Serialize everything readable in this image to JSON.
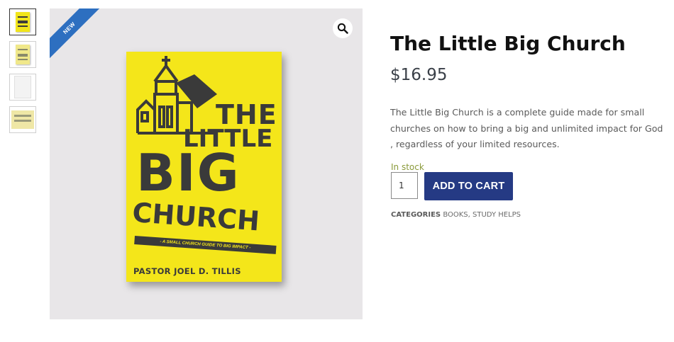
{
  "thumbnails": [
    "book-cover-front",
    "book-cover-alt",
    "book-pages",
    "book-back"
  ],
  "gallery": {
    "badge": "NEW",
    "cover": {
      "line1": "THE",
      "line2": "LITTLE",
      "line3": "BIG",
      "line4": "CHURCH",
      "subtitle": "- A SMALL CHURCH GUIDE TO BIG IMPACT -",
      "author": "PASTOR JOEL D. TILLIS"
    }
  },
  "product": {
    "title": "The Little Big Church",
    "price": "$16.95",
    "description": "The Little Big Church is a complete guide made for small churches on how to bring a big and unlimited impact for God , regardless of your limited resources.",
    "stock": "In stock",
    "quantity": "1",
    "add_to_cart": "ADD TO CART",
    "categories_label": "CATEGORIES",
    "category_1": "BOOKS",
    "separator": ",",
    "category_2": "STUDY HELPS"
  },
  "colors": {
    "accent": "#253a84",
    "badge": "#2d6fc0",
    "cover": "#f4e61a",
    "stock": "#8a9a3a"
  }
}
